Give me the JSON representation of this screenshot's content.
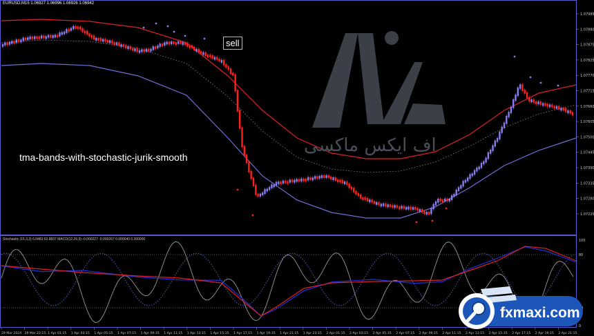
{
  "window": {
    "symbol_header": "EURUSD,M15  1.06927 1.06996 1.06926 1.06942"
  },
  "indicator_header": "Stochastic (15,3,3) 6.0483 63.8837  MACD(12,26,9) -0.000227 -0.000267 0.000040 0.000000",
  "strategy_title": "tma-bands-with-stochastic-jurik-smooth",
  "signal_label": "sell",
  "watermark_text": "اف ایکس ماکسی",
  "brand_badge": {
    "text": "fxmaxi.com",
    "icon": "magnifier-icon"
  },
  "price_axis": [
    "1.07985",
    "1.07880",
    "1.07875",
    "1.07825",
    "1.07770",
    "1.07715",
    "1.07660",
    "1.07605",
    "1.07500",
    "1.07445",
    "1.07390",
    "1.07335",
    "1.07280",
    "1.07225"
  ],
  "osc_axis": [
    "100",
    "80",
    "20",
    "0"
  ],
  "time_axis": [
    "29 Mar 2024",
    "29 Mar 22:15",
    "1 Apr 01:15",
    "1 Apr 03:15",
    "1 Apr 05:15",
    "1 Apr 07:15",
    "1 Apr 09:15",
    "1 Apr 11:15",
    "1 Apr 13:15",
    "1 Apr 15:15",
    "1 Apr 17:15",
    "1 Apr 19:15",
    "1 Apr 21:15",
    "1 Apr 23:15",
    "2 Apr 01:15",
    "2 Apr 03:15",
    "2 Apr 05:15",
    "2 Apr 07:15",
    "2 Apr 09:15",
    "2 Apr 11:15",
    "2 Apr 13:15",
    "2 Apr 15:15",
    "2 Apr 17:15",
    "2 Apr 19:15",
    "2 Apr 21:15"
  ],
  "colors": {
    "bull": "#8a7ff0",
    "bear": "#ff2020",
    "upper_band": "#e0202a",
    "lower_band": "#6f6fd8",
    "stoch_main": "#e02020",
    "stoch_signal": "#2030e0",
    "frame": "#5a5ad0"
  }
}
